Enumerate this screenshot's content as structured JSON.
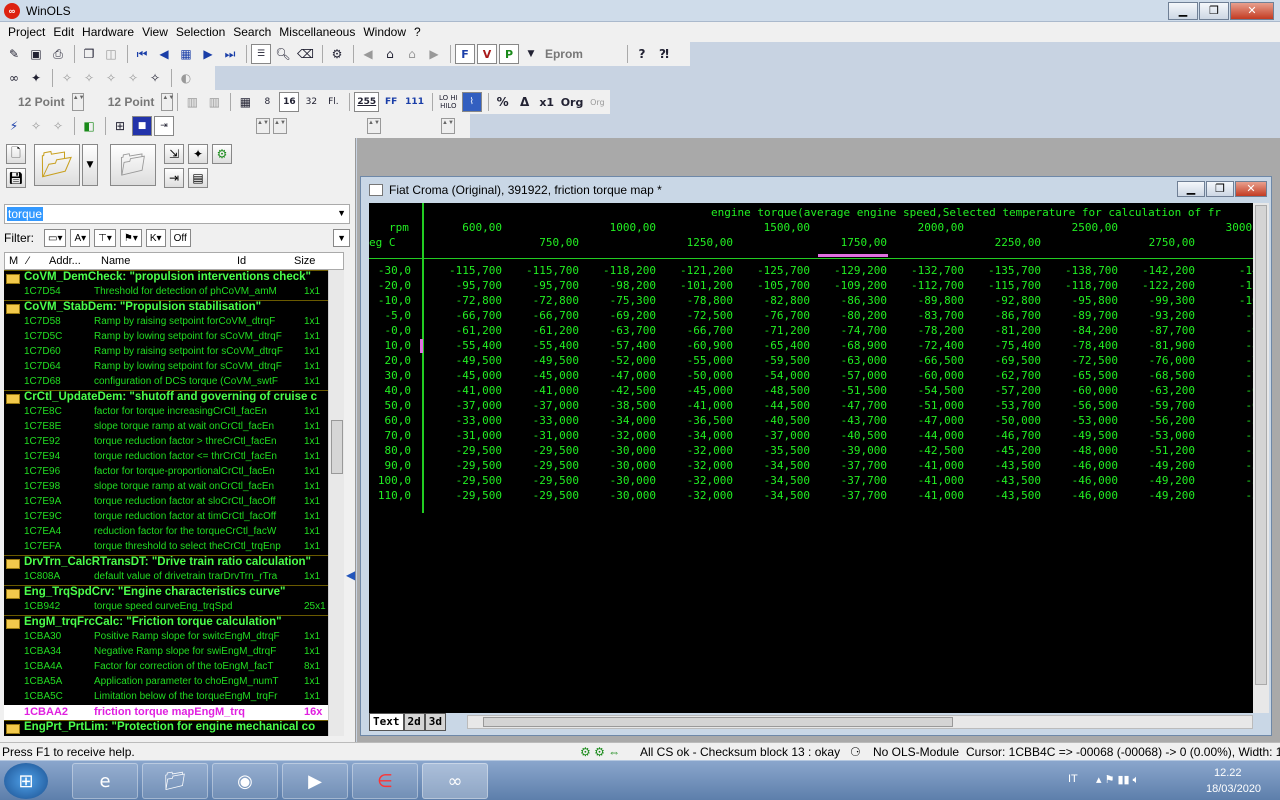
{
  "app": {
    "title": "WinOLS"
  },
  "menu": [
    "Project",
    "Edit",
    "Hardware",
    "View",
    "Selection",
    "Search",
    "Miscellaneous",
    "Window",
    "?"
  ],
  "toolbar": {
    "eprom_label": "Eprom",
    "font_size_1": "12 Point",
    "font_size_2": "12 Point",
    "btn_255": "255",
    "btn_ff": "FF",
    "btn_111": "111",
    "btn_8": "8",
    "btn_16": "16",
    "btn_32": "32",
    "btn_fl": "Fl.",
    "btn_lohi": "LO HI",
    "btn_hilo": "HILO",
    "btn_x1": "x1",
    "btn_org": "Org"
  },
  "search": {
    "value": "torque"
  },
  "filter": {
    "label": "Filter:",
    "off_label": "Off"
  },
  "list": {
    "columns": [
      "M",
      "Addr...",
      "Name",
      "Id",
      "Size"
    ],
    "items": [
      {
        "type": "group",
        "text": "CoVM_DemCheck: \"propulsion interventions check\""
      },
      {
        "type": "item",
        "addr": "1C7D54",
        "name": "Threshold for detection of ph",
        "id": "CoVM_amM",
        "size": "1x1"
      },
      {
        "type": "group",
        "text": "CoVM_StabDem: \"Propulsion stabilisation\""
      },
      {
        "type": "item",
        "addr": "1C7D58",
        "name": "Ramp by raising setpoint for",
        "id": "CoVM_dtrqF",
        "size": "1x1"
      },
      {
        "type": "item",
        "addr": "1C7D5C",
        "name": "Ramp by lowing setpoint for s",
        "id": "CoVM_dtrqF",
        "size": "1x1"
      },
      {
        "type": "item",
        "addr": "1C7D60",
        "name": "Ramp by raising setpoint for s",
        "id": "CoVM_dtrqF",
        "size": "1x1"
      },
      {
        "type": "item",
        "addr": "1C7D64",
        "name": "Ramp by lowing setpoint for s",
        "id": "CoVM_dtrqF",
        "size": "1x1"
      },
      {
        "type": "item",
        "addr": "1C7D68",
        "name": "configuration of DCS torque (",
        "id": "CoVM_swtF",
        "size": "1x1"
      },
      {
        "type": "group",
        "text": "CrCtl_UpdateDem: \"shutoff and governing of cruise c"
      },
      {
        "type": "item",
        "addr": "1C7E8C",
        "name": "factor for torque increasing",
        "id": "CrCtl_facEn",
        "size": "1x1"
      },
      {
        "type": "item",
        "addr": "1C7E8E",
        "name": "slope torque ramp at wait on",
        "id": "CrCtl_facEn",
        "size": "1x1"
      },
      {
        "type": "item",
        "addr": "1C7E92",
        "name": "torque reduction factor > thre",
        "id": "CrCtl_facEn",
        "size": "1x1"
      },
      {
        "type": "item",
        "addr": "1C7E94",
        "name": "torque reduction factor <= thr",
        "id": "CrCtl_facEn",
        "size": "1x1"
      },
      {
        "type": "item",
        "addr": "1C7E96",
        "name": "factor for torque-proportional",
        "id": "CrCtl_facEn",
        "size": "1x1"
      },
      {
        "type": "item",
        "addr": "1C7E98",
        "name": "slope torque ramp at wait on",
        "id": "CrCtl_facEn",
        "size": "1x1"
      },
      {
        "type": "item",
        "addr": "1C7E9A",
        "name": "torque reduction factor at slo",
        "id": "CrCtl_facOff",
        "size": "1x1"
      },
      {
        "type": "item",
        "addr": "1C7E9C",
        "name": "torque reduction factor at tim",
        "id": "CrCtl_facOff",
        "size": "1x1"
      },
      {
        "type": "item",
        "addr": "1C7EA4",
        "name": "reduction factor for the torque",
        "id": "CrCtl_facW",
        "size": "1x1"
      },
      {
        "type": "item",
        "addr": "1C7EFA",
        "name": "torque threshold to select the",
        "id": "CrCtl_trqEnp",
        "size": "1x1"
      },
      {
        "type": "group",
        "text": "DrvTrn_CalcRTransDT: \"Drive train ratio calculation\""
      },
      {
        "type": "item",
        "addr": "1C808A",
        "name": "default value of drivetrain trar",
        "id": "DrvTrn_rTra",
        "size": "1x1"
      },
      {
        "type": "group",
        "text": "Eng_TrqSpdCrv: \"Engine characteristics curve\""
      },
      {
        "type": "item",
        "addr": "1CB942",
        "name": "torque speed curve",
        "id": "Eng_trqSpd",
        "size": "25x1"
      },
      {
        "type": "group",
        "text": "EngM_trqFrcCalc: \"Friction torque calculation\""
      },
      {
        "type": "item",
        "addr": "1CBA30",
        "name": "Positive Ramp slope for switc",
        "id": "EngM_dtrqF",
        "size": "1x1"
      },
      {
        "type": "item",
        "addr": "1CBA34",
        "name": "Negative Ramp slope for swi",
        "id": "EngM_dtrqF",
        "size": "1x1"
      },
      {
        "type": "item",
        "addr": "1CBA4A",
        "name": "Factor for correction of the to",
        "id": "EngM_facT",
        "size": "8x1"
      },
      {
        "type": "item",
        "addr": "1CBA5A",
        "name": "Application parameter to cho",
        "id": "EngM_numT",
        "size": "1x1"
      },
      {
        "type": "item",
        "addr": "1CBA5C",
        "name": "Limitation below of the torque",
        "id": "EngM_trqFr",
        "size": "1x1"
      },
      {
        "type": "selected",
        "addr": "1CBAA2",
        "name": "friction torque map",
        "id": "EngM_trq",
        "size": "16x"
      },
      {
        "type": "group",
        "text": "EngPrt_PrtLim: \"Protection for engine mechanical co"
      }
    ]
  },
  "map_window": {
    "title": "Fiat Croma (Original), 391922, friction torque map *",
    "axis_title": "engine torque(average engine speed,Selected temperature for calculation of fr",
    "x_unit": "rpm",
    "y_unit": "eg C",
    "x_row1": [
      "600,00",
      "1000,00",
      "1500,00",
      "2000,00",
      "2500,00",
      "3000,00"
    ],
    "x_row2": [
      "750,00",
      "1250,00",
      "1750,00",
      "2250,00",
      "2750,00"
    ],
    "rows": [
      {
        "y": "-30,0",
        "v": [
          "-115,700",
          "-115,700",
          "-118,200",
          "-121,200",
          "-125,700",
          "-129,200",
          "-132,700",
          "-135,700",
          "-138,700",
          "-142,200",
          "-145,"
        ]
      },
      {
        "y": "-20,0",
        "v": [
          "-95,700",
          "-95,700",
          "-98,200",
          "-101,200",
          "-105,700",
          "-109,200",
          "-112,700",
          "-115,700",
          "-118,700",
          "-122,200",
          "-125,"
        ]
      },
      {
        "y": "-10,0",
        "v": [
          "-72,800",
          "-72,800",
          "-75,300",
          "-78,800",
          "-82,800",
          "-86,300",
          "-89,800",
          "-92,800",
          "-95,800",
          "-99,300",
          "-102,"
        ]
      },
      {
        "y": "-5,0",
        "v": [
          "-66,700",
          "-66,700",
          "-69,200",
          "-72,500",
          "-76,700",
          "-80,200",
          "-83,700",
          "-86,700",
          "-89,700",
          "-93,200",
          "-96,"
        ]
      },
      {
        "y": "-0,0",
        "v": [
          "-61,200",
          "-61,200",
          "-63,700",
          "-66,700",
          "-71,200",
          "-74,700",
          "-78,200",
          "-81,200",
          "-84,200",
          "-87,700",
          "-91,"
        ]
      },
      {
        "y": "10,0",
        "v": [
          "-55,400",
          "-55,400",
          "-57,400",
          "-60,900",
          "-65,400",
          "-68,900",
          "-72,400",
          "-75,400",
          "-78,400",
          "-81,900",
          "-85,"
        ]
      },
      {
        "y": "20,0",
        "v": [
          "-49,500",
          "-49,500",
          "-52,000",
          "-55,000",
          "-59,500",
          "-63,000",
          "-66,500",
          "-69,500",
          "-72,500",
          "-76,000",
          "-79,"
        ]
      },
      {
        "y": "30,0",
        "v": [
          "-45,000",
          "-45,000",
          "-47,000",
          "-50,000",
          "-54,000",
          "-57,000",
          "-60,000",
          "-62,700",
          "-65,500",
          "-68,500",
          "-71,"
        ]
      },
      {
        "y": "40,0",
        "v": [
          "-41,000",
          "-41,000",
          "-42,500",
          "-45,000",
          "-48,500",
          "-51,500",
          "-54,500",
          "-57,200",
          "-60,000",
          "-63,200",
          "-66,"
        ]
      },
      {
        "y": "50,0",
        "v": [
          "-37,000",
          "-37,000",
          "-38,500",
          "-41,000",
          "-44,500",
          "-47,700",
          "-51,000",
          "-53,700",
          "-56,500",
          "-59,700",
          "-63,"
        ]
      },
      {
        "y": "60,0",
        "v": [
          "-33,000",
          "-33,000",
          "-34,000",
          "-36,500",
          "-40,500",
          "-43,700",
          "-47,000",
          "-50,000",
          "-53,000",
          "-56,200",
          "-59,"
        ]
      },
      {
        "y": "70,0",
        "v": [
          "-31,000",
          "-31,000",
          "-32,000",
          "-34,000",
          "-37,000",
          "-40,500",
          "-44,000",
          "-46,700",
          "-49,500",
          "-53,000",
          "-56,"
        ]
      },
      {
        "y": "80,0",
        "v": [
          "-29,500",
          "-29,500",
          "-30,000",
          "-32,000",
          "-35,500",
          "-39,000",
          "-42,500",
          "-45,200",
          "-48,000",
          "-51,200",
          "-54,"
        ]
      },
      {
        "y": "90,0",
        "v": [
          "-29,500",
          "-29,500",
          "-30,000",
          "-32,000",
          "-34,500",
          "-37,700",
          "-41,000",
          "-43,500",
          "-46,000",
          "-49,200",
          "-52,"
        ]
      },
      {
        "y": "100,0",
        "v": [
          "-29,500",
          "-29,500",
          "-30,000",
          "-32,000",
          "-34,500",
          "-37,700",
          "-41,000",
          "-43,500",
          "-46,000",
          "-49,200",
          "-52,"
        ]
      },
      {
        "y": "110,0",
        "v": [
          "-29,500",
          "-29,500",
          "-30,000",
          "-32,000",
          "-34,500",
          "-37,700",
          "-41,000",
          "-43,500",
          "-46,000",
          "-49,200",
          "-52,"
        ]
      }
    ],
    "tabs": [
      "Text",
      "2d",
      "3d"
    ]
  },
  "status": {
    "help": "Press F1 to receive help.",
    "checksum": "All CS ok - Checksum block 13 : okay",
    "module": "No OLS-Module",
    "cursor": "Cursor: 1CBB4C => -00068 (-00068) -> 0 (0.00%), Width: 16"
  },
  "taskbar": {
    "lang": "IT",
    "time": "12.22",
    "date": "18/03/2020"
  }
}
